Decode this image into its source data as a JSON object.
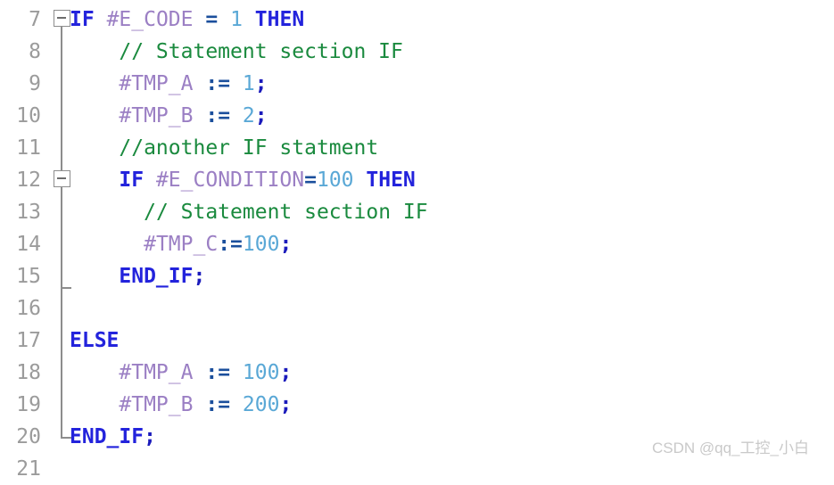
{
  "editor": {
    "language": "SCL",
    "first_visible_line": 7,
    "gutter_color": "#9b9b9b",
    "background": "#ffffff",
    "syntax_colors": {
      "keyword": "#2323dc",
      "comment": "#1a8a3e",
      "variable": "#9b7fc4",
      "operator": "#1b4f9c",
      "number": "#5aa8d6",
      "punctuation": "#1b1bbb"
    },
    "lines": [
      {
        "number": "7",
        "indent": 0,
        "fold": "open",
        "tokens": [
          {
            "t": "IF",
            "c": "keyword"
          },
          {
            "t": " ",
            "c": "plain"
          },
          {
            "t": "#E_CODE",
            "c": "var"
          },
          {
            "t": " ",
            "c": "plain"
          },
          {
            "t": "=",
            "c": "op"
          },
          {
            "t": " ",
            "c": "plain"
          },
          {
            "t": "1",
            "c": "num"
          },
          {
            "t": " ",
            "c": "plain"
          },
          {
            "t": "THEN",
            "c": "keyword"
          }
        ]
      },
      {
        "number": "8",
        "indent": 4,
        "fold": "none",
        "tokens": [
          {
            "t": "// Statement section IF",
            "c": "comment"
          }
        ]
      },
      {
        "number": "9",
        "indent": 4,
        "fold": "none",
        "tokens": [
          {
            "t": "#TMP_A",
            "c": "var"
          },
          {
            "t": " ",
            "c": "plain"
          },
          {
            "t": ":=",
            "c": "op"
          },
          {
            "t": " ",
            "c": "plain"
          },
          {
            "t": "1",
            "c": "num"
          },
          {
            "t": ";",
            "c": "punct"
          }
        ]
      },
      {
        "number": "10",
        "indent": 4,
        "fold": "none",
        "tokens": [
          {
            "t": "#TMP_B",
            "c": "var"
          },
          {
            "t": " ",
            "c": "plain"
          },
          {
            "t": ":=",
            "c": "op"
          },
          {
            "t": " ",
            "c": "plain"
          },
          {
            "t": "2",
            "c": "num"
          },
          {
            "t": ";",
            "c": "punct"
          }
        ]
      },
      {
        "number": "11",
        "indent": 4,
        "fold": "none",
        "tokens": [
          {
            "t": "//another IF statment",
            "c": "comment"
          }
        ]
      },
      {
        "number": "12",
        "indent": 4,
        "fold": "open",
        "tokens": [
          {
            "t": "IF",
            "c": "keyword"
          },
          {
            "t": " ",
            "c": "plain"
          },
          {
            "t": "#E_CONDITION",
            "c": "var"
          },
          {
            "t": "=",
            "c": "op"
          },
          {
            "t": "100",
            "c": "num"
          },
          {
            "t": " ",
            "c": "plain"
          },
          {
            "t": "THEN",
            "c": "keyword"
          }
        ]
      },
      {
        "number": "13",
        "indent": 6,
        "fold": "none",
        "tokens": [
          {
            "t": "// Statement section IF",
            "c": "comment"
          }
        ]
      },
      {
        "number": "14",
        "indent": 6,
        "fold": "none",
        "tokens": [
          {
            "t": "#TMP_C",
            "c": "var"
          },
          {
            "t": ":=",
            "c": "op"
          },
          {
            "t": "100",
            "c": "num"
          },
          {
            "t": ";",
            "c": "punct"
          }
        ]
      },
      {
        "number": "15",
        "indent": 4,
        "fold": "end",
        "tokens": [
          {
            "t": "END_IF",
            "c": "keyword"
          },
          {
            "t": ";",
            "c": "punct"
          }
        ]
      },
      {
        "number": "16",
        "indent": 0,
        "fold": "none",
        "tokens": []
      },
      {
        "number": "17",
        "indent": 0,
        "fold": "none",
        "tokens": [
          {
            "t": "ELSE",
            "c": "keyword"
          }
        ]
      },
      {
        "number": "18",
        "indent": 4,
        "fold": "none",
        "tokens": [
          {
            "t": "#TMP_A",
            "c": "var"
          },
          {
            "t": " ",
            "c": "plain"
          },
          {
            "t": ":=",
            "c": "op"
          },
          {
            "t": " ",
            "c": "plain"
          },
          {
            "t": "100",
            "c": "num"
          },
          {
            "t": ";",
            "c": "punct"
          }
        ]
      },
      {
        "number": "19",
        "indent": 4,
        "fold": "none",
        "tokens": [
          {
            "t": "#TMP_B",
            "c": "var"
          },
          {
            "t": " ",
            "c": "plain"
          },
          {
            "t": ":=",
            "c": "op"
          },
          {
            "t": " ",
            "c": "plain"
          },
          {
            "t": "200",
            "c": "num"
          },
          {
            "t": ";",
            "c": "punct"
          }
        ]
      },
      {
        "number": "20",
        "indent": 0,
        "fold": "end-outer",
        "tokens": [
          {
            "t": "END_IF",
            "c": "keyword"
          },
          {
            "t": ";",
            "c": "punct"
          }
        ]
      },
      {
        "number": "21",
        "indent": 0,
        "fold": "none",
        "tokens": []
      }
    ]
  },
  "watermark": {
    "text": "CSDN @qq_工控_小白",
    "color": "#c9c9c9"
  }
}
